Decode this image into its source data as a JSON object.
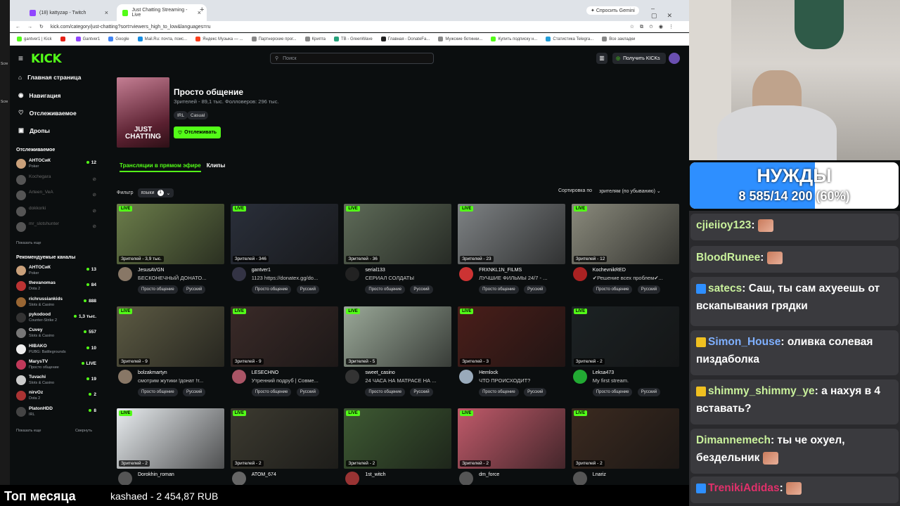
{
  "browser": {
    "tabs": [
      {
        "label": "(18) kattyzap - Twitch",
        "color": "#9146ff"
      },
      {
        "label": "Just Chatting Streaming - Live",
        "color": "#53fc18"
      }
    ],
    "gemini_label": "Спросить Gemini",
    "url": "kick.com/category/just-chatting?sort=viewers_high_to_low&languages=ru",
    "bookmarks": [
      {
        "label": "gantver1 | Kick",
        "color": "#53fc18"
      },
      {
        "label": "",
        "color": "#e62117"
      },
      {
        "label": "Gantver1",
        "color": "#9146ff"
      },
      {
        "label": "Google",
        "color": "#4285f4"
      },
      {
        "label": "Mail.Ru: почта, поис...",
        "color": "#168de2"
      },
      {
        "label": "Яндекс Музыка — ...",
        "color": "#fc3f1d"
      },
      {
        "label": "Партнерские прог...",
        "color": "#888888"
      },
      {
        "label": "Крипта",
        "color": "#888888"
      },
      {
        "label": "TB - GreenWave",
        "color": "#26a17b"
      },
      {
        "label": "Главная - DonateFa...",
        "color": "#222222"
      },
      {
        "label": "Мужские ботинки...",
        "color": "#888888"
      },
      {
        "label": "Купить подписку н...",
        "color": "#53fc18"
      },
      {
        "label": "Статистика Telegra...",
        "color": "#229ed9"
      },
      {
        "label": "Все закладки",
        "color": "#888888"
      }
    ]
  },
  "kick": {
    "logo": "KICK",
    "search_placeholder": "Поиск",
    "get_kicks": "Получить KICKs",
    "nav": [
      {
        "label": "Главная страница",
        "icon": "home-icon",
        "glyph": "⌂"
      },
      {
        "label": "Навигация",
        "icon": "compass-icon",
        "glyph": "◉"
      },
      {
        "label": "Отслеживаемое",
        "icon": "heart-icon",
        "glyph": "♡"
      },
      {
        "label": "Дропы",
        "icon": "gift-icon",
        "glyph": "▣"
      }
    ],
    "followed_header": "Отслеживаемое",
    "followed": [
      {
        "name": "АНТОСиК",
        "category": "Poker",
        "count": "12",
        "online": true,
        "color": "#c9a07a"
      },
      {
        "name": "Kochegara",
        "category": "",
        "count": "",
        "online": false,
        "color": "#555555"
      },
      {
        "name": "Arteen_VeA",
        "category": "",
        "count": "",
        "online": false,
        "color": "#555555"
      },
      {
        "name": "dokkorki",
        "category": "",
        "count": "",
        "online": false,
        "color": "#555555"
      },
      {
        "name": "mr_slotshunter",
        "category": "",
        "count": "",
        "online": false,
        "color": "#555555"
      }
    ],
    "show_more_1": "Показать еще",
    "recommended_header": "Рекомендуемые каналы",
    "recommended": [
      {
        "name": "АНТОСиК",
        "category": "Poker",
        "count": "13",
        "color": "#c9a07a"
      },
      {
        "name": "thevanomas",
        "category": "Dota 2",
        "count": "84",
        "color": "#b33"
      },
      {
        "name": "richrussiankids",
        "category": "Slots & Casino",
        "count": "888",
        "color": "#996633"
      },
      {
        "name": "pykodood",
        "category": "Counter-Strike 2",
        "count": "1,3 тыс.",
        "color": "#333"
      },
      {
        "name": "Cuvey",
        "category": "Slots & Casino",
        "count": "557",
        "color": "#777"
      },
      {
        "name": "HIBAKO",
        "category": "PUBG: Battlegrounds",
        "count": "10",
        "color": "#eee"
      },
      {
        "name": "MarysTV",
        "category": "Просто общение",
        "count": "LIVE",
        "color": "#c0395a"
      },
      {
        "name": "Tuvachi",
        "category": "Slots & Casino",
        "count": "19",
        "color": "#ccc"
      },
      {
        "name": "nirvOz",
        "category": "Dota 2",
        "count": "2",
        "color": "#a33"
      },
      {
        "name": "PlatonHDD",
        "category": "IRL",
        "count": "8",
        "color": "#444"
      }
    ],
    "show_more_2": "Показать еще",
    "collapse": "Свернуть",
    "category": {
      "title": "Просто общение",
      "stats": "Зрителей - 89,1 тыс.   Фолловеров: 296 тыс.",
      "tags": [
        "IRL",
        "Casual"
      ],
      "cover_text": "JUST CHATTING",
      "follow": "Отслеживать"
    },
    "tabs": [
      "Трансляции в прямом эфире",
      "Клипы"
    ],
    "filter_label": "Фильтр",
    "filter_lang": "языки",
    "filter_count": "1",
    "sort_label": "Сортировка по",
    "sort_value": "зрителям (по убыванию)",
    "live_label": "LIVE",
    "streams": [
      {
        "viewers": "Зрителей - 3,9 тыс.",
        "channel": "JesusAVGN",
        "title": "БЕСКОНЕЧНЫЙ ДОНАТО...",
        "tags": [
          "Просто общение",
          "Русский"
        ],
        "thumb": "#6b7d4a",
        "avatar": "#887766"
      },
      {
        "viewers": "Зрителей - 346",
        "channel": "gantver1",
        "title": "1123 https://donatex.gg/do...",
        "tags": [
          "Просто общение",
          "Русский"
        ],
        "thumb": "#2a2f3a",
        "avatar": "#334"
      },
      {
        "viewers": "Зрителей - 36",
        "channel": "serial133",
        "title": "СЕРИАЛ СОЛДАТЫ",
        "tags": [
          "Просто общение",
          "Русский"
        ],
        "thumb": "#5e6b58",
        "avatar": "#222"
      },
      {
        "viewers": "Зрителей - 23",
        "channel": "FRXNKL1N_FILMS",
        "title": "ЛУЧШИЕ ФИЛЬМЫ 24/7 - ...",
        "tags": [
          "Просто общение",
          "Русский"
        ],
        "thumb": "#7e8284",
        "avatar": "#c33"
      },
      {
        "viewers": "Зрителей - 12",
        "channel": "KochevnikRED",
        "title": "✔Решение всех проблем✔...",
        "tags": [
          "Просто общение",
          "Русский"
        ],
        "thumb": "#8a8a7c",
        "avatar": "#a22"
      },
      {
        "viewers": "Зрителей - 9",
        "channel": "bolzakmartyn",
        "title": "смотрим жутики !донат !т...",
        "tags": [
          "Просто общение",
          "Русский"
        ],
        "thumb": "#5c5a43",
        "avatar": "#876"
      },
      {
        "viewers": "Зрителей - 9",
        "channel": "LESECHNO",
        "title": "Утренний подруб | Совме...",
        "tags": [
          "Просто общение",
          "Русский"
        ],
        "thumb": "#3a2a28",
        "avatar": "#a56"
      },
      {
        "viewers": "Зрителей - 5",
        "channel": "sweet_casino",
        "title": "24 ЧАСА НА МАТРАСЕ НА ...",
        "tags": [
          "Просто общение",
          "Русский"
        ],
        "thumb": "#9aa898",
        "avatar": "#333"
      },
      {
        "viewers": "Зрителей - 3",
        "channel": "Hemlock",
        "title": "ЧТО ПРОИСХОДИТ?",
        "tags": [
          "Просто общение",
          "Русский"
        ],
        "thumb": "#4a1e1a",
        "avatar": "#9ab"
      },
      {
        "viewers": "Зрителей - 2",
        "channel": "Leksa473",
        "title": "My first stream.",
        "tags": [
          "Просто общение",
          "Русский"
        ],
        "thumb": "#1c2224",
        "avatar": "#2a3"
      },
      {
        "viewers": "Зрителей - 2",
        "channel": "Dorokhin_roman",
        "title": "",
        "tags": [],
        "thumb": "#e8ecef",
        "avatar": "#555"
      },
      {
        "viewers": "Зрителей - 2",
        "channel": "ATOM_674",
        "title": "",
        "tags": [],
        "thumb": "#3c3a30",
        "avatar": "#666"
      },
      {
        "viewers": "Зрителей - 2",
        "channel": "1st_witch",
        "title": "",
        "tags": [],
        "thumb": "#3e5a33",
        "avatar": "#933"
      },
      {
        "viewers": "Зрителей - 2",
        "channel": "dm_force",
        "title": "",
        "tags": [],
        "thumb": "#c05a6a",
        "avatar": "#555"
      },
      {
        "viewers": "Зрителей - 2",
        "channel": "Lnariz",
        "title": "",
        "tags": [],
        "thumb": "#3b2a20",
        "avatar": "#555"
      }
    ]
  },
  "overlay": {
    "goal_title": "НУЖДЫ",
    "goal_value": "8 585/14 200 (60%)",
    "goal_progress": 0.6,
    "chat": [
      {
        "user": "cjieiioy123",
        "text": ":",
        "color": "#c9f19c",
        "badge": "",
        "emote": true
      },
      {
        "user": "BloodRunee",
        "text": ":",
        "color": "#c9f19c",
        "badge": "",
        "emote": true
      },
      {
        "user": "satecs",
        "text": ": Саш, ты сам ахуеешь от вскапывания грядки",
        "color": "#c9f19c",
        "badge": "#2e8fff",
        "emote": false
      },
      {
        "user": "Simon_House",
        "text": ": оливка солевая пиздаболка",
        "color": "#7fb0ff",
        "badge": "#f0c020",
        "emote": false
      },
      {
        "user": "shimmy_shimmy_ye",
        "text": ": а нахуя в 4 вставать?",
        "color": "#c9f19c",
        "badge": "#f0c020",
        "emote": false
      },
      {
        "user": "Dimannemech",
        "text": ": ты че охуел, бездельник",
        "color": "#c9f19c",
        "badge": "",
        "emote": true
      },
      {
        "user": "TrenikiAdidas",
        "text": ":",
        "color": "#e0306a",
        "badge": "#2e8fff",
        "emote": true
      }
    ],
    "bottom_title": "Топ месяца",
    "bottom_value": "kashaed - 2 454,87 RUB"
  }
}
